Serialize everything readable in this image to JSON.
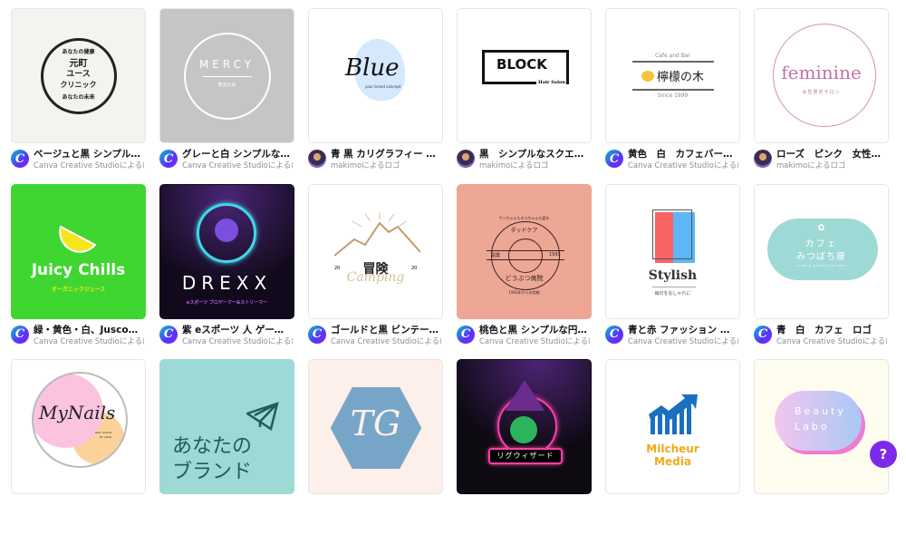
{
  "templates": [
    {
      "title": "ベージュと黒 シンプルな円形 ...",
      "author": "Canva Creative Studioによるロゴ",
      "avatar": "canva",
      "bg": "#f3f3ef",
      "logo": {
        "top": "あなたの健康",
        "main1": "元町",
        "main2": "ユース",
        "main3": "クリニック",
        "bottom": "あなたの未来"
      }
    },
    {
      "title": "グレーと白 シンプルな円形 教...",
      "author": "Canva Creative Studioによるロゴ",
      "avatar": "canva",
      "bg": "#c5c5c5",
      "logo": {
        "main": "MERCY",
        "sub": "慈善の会"
      }
    },
    {
      "title": "青 黒 カリグラフィー 素朴 ロゴ",
      "author": "makimoによるロゴ",
      "avatar": "makimo",
      "bg": "#ffffff",
      "logo": {
        "main": "Blue",
        "sub": "your brand concept"
      }
    },
    {
      "title": "黒　シンプルなスクエア　サ...",
      "author": "makimoによるロゴ",
      "avatar": "makimo",
      "bg": "#ffffff",
      "logo": {
        "main": "BLOCK",
        "sub": "Hair Salon"
      }
    },
    {
      "title": "黄色　白　カフェバー　ロゴ",
      "author": "Canva Creative Studioによるロゴ",
      "avatar": "canva",
      "bg": "#ffffff",
      "logo": {
        "top": "Cafe and Bar",
        "main": "檸檬の木",
        "bottom": "Since 1999"
      }
    },
    {
      "title": "ローズ　ピンク　女性　美容...",
      "author": "makimoによるロゴ",
      "avatar": "makimo",
      "bg": "#ffffff",
      "logo": {
        "main": "feminine",
        "sub": "女性限定サロン"
      }
    },
    {
      "title": "緑・黄色・白、Jusco・柑橘...",
      "author": "Canva Creative Studioによるロゴ",
      "avatar": "canva",
      "bg": "#3fd631",
      "logo": {
        "main": "Juicy Chills",
        "sub": "オーガニックジュース"
      }
    },
    {
      "title": "紫 eスポーツ 人 ゲームロゴ",
      "author": "Canva Creative Studioによるロゴ",
      "avatar": "canva",
      "bg": "#120a1c",
      "logo": {
        "main": "DREXX",
        "sub": "eスポーツ ブロゲーマー&ストリーマー"
      }
    },
    {
      "title": "ゴールドと黒 ビンテージ ロゴ ...",
      "author": "Canva Creative Studioによるロゴ",
      "avatar": "canva",
      "bg": "#ffffff",
      "logo": {
        "main": "冒険",
        "script": "Camping",
        "left": "20",
        "right": "20"
      }
    },
    {
      "title": "桃色と黒 シンプルな円形 動物...",
      "author": "Canva Creative Studioによるロゴ",
      "avatar": "canva",
      "bg": "#eda794",
      "logo": {
        "top": "ワンちゃんもネコちゃんも愛を",
        "arc": "ダッドケア",
        "left": "開業",
        "right": "1993",
        "main": "どうぶつ病院",
        "bottom": "1993年からの信頼"
      }
    },
    {
      "title": "青と赤 ファッション オンライ...",
      "author": "Canva Creative Studioによるロゴ",
      "avatar": "canva",
      "bg": "#ffffff",
      "logo": {
        "main": "Stylish",
        "sub": "毎日をおしゃれに"
      }
    },
    {
      "title": "青　白　カフェ　ロゴ",
      "author": "Canva Creative Studioによるロゴ",
      "avatar": "canva",
      "bg": "#ffffff",
      "logo": {
        "main1": "カフェ",
        "main2": "みつばち屋",
        "sub": "HAVE A GREAT COFFEE!"
      }
    },
    {
      "title": "",
      "author": "",
      "avatar": "",
      "bg": "#ffffff",
      "logo": {
        "main": "MyNails",
        "sub1": "NAIL SALON",
        "sub2": "BY ALISA"
      }
    },
    {
      "title": "",
      "author": "",
      "avatar": "",
      "bg": "#9ed9d6",
      "logo": {
        "main1": "あなたの",
        "main2": "ブランド"
      }
    },
    {
      "title": "",
      "author": "",
      "avatar": "",
      "bg": "#fdf0ea",
      "logo": {
        "main": "TG"
      }
    },
    {
      "title": "",
      "author": "",
      "avatar": "",
      "bg": "#0d0a12",
      "logo": {
        "main": "リグウィザード"
      }
    },
    {
      "title": "",
      "author": "",
      "avatar": "",
      "bg": "#ffffff",
      "logo": {
        "main1": "Milcheur",
        "main2": "Media"
      }
    },
    {
      "title": "",
      "author": "",
      "avatar": "",
      "bg": "#fffcf0",
      "logo": {
        "main1": "Beauty",
        "main2": "Labo"
      }
    }
  ],
  "help_button": "?",
  "colors": {
    "canva_purple": "#7d2ae8",
    "text": "#0e1318",
    "subtext": "#8a8f98"
  }
}
